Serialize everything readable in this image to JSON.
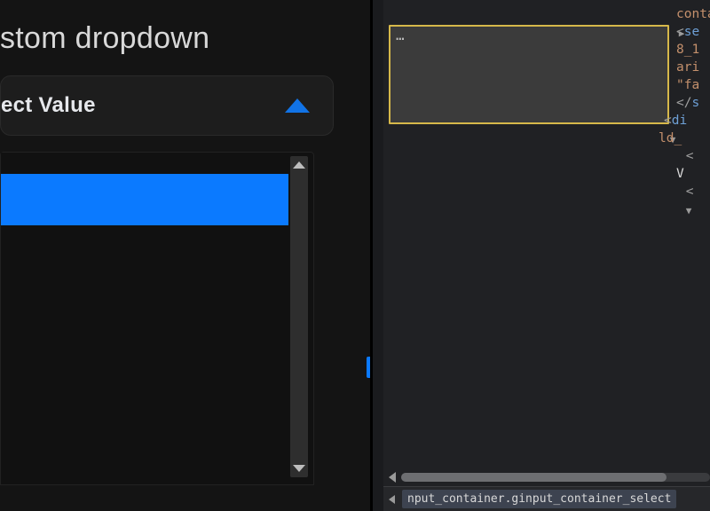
{
  "preview": {
    "title": "stom dropdown",
    "dropdown_label": "ect Value"
  },
  "dom": {
    "ellipsis": "…",
    "lines": [
      {
        "class": "c-attr",
        "text": "conta"
      },
      {
        "class": "c-punct",
        "text": "<",
        "tag": "se"
      },
      {
        "class": "c-attr",
        "text": "8_1"
      },
      {
        "class": "c-attr",
        "text": "ari"
      },
      {
        "class": "c-str",
        "text": "\"fa"
      },
      {
        "class": "c-punct",
        "text": "</",
        "tag": "s"
      },
      {
        "class": "c-punct",
        "text": "<",
        "tag": "di"
      },
      {
        "class": "c-attr",
        "text": "ld_"
      },
      {
        "class": "c-punct",
        "text": " <"
      },
      {
        "class": "c-plain",
        "text": "V"
      },
      {
        "class": "c-punct",
        "text": " <"
      }
    ]
  },
  "breadcrumb": {
    "selected": "nput_container.ginput_container_select"
  }
}
